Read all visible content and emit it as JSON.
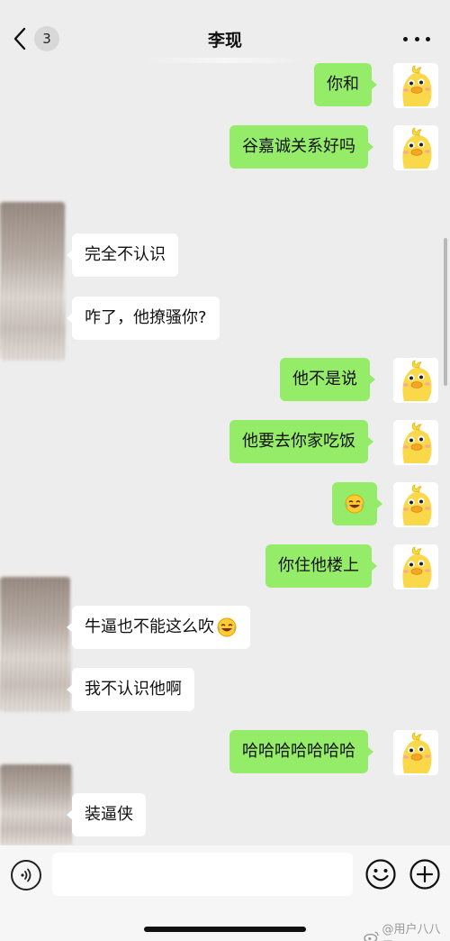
{
  "header": {
    "unread_count": "3",
    "title": "李现"
  },
  "messages": [
    {
      "side": "me",
      "text": "你和"
    },
    {
      "side": "me",
      "text": "谷嘉诚关系好吗"
    },
    {
      "side": "them",
      "text": "完全不认识"
    },
    {
      "side": "them",
      "text": "咋了，他撩骚你?"
    },
    {
      "side": "me",
      "text": "他不是说"
    },
    {
      "side": "me",
      "text": "他要去你家吃饭"
    },
    {
      "side": "me",
      "text": "",
      "emoji": "rofl-emoji-icon"
    },
    {
      "side": "me",
      "text": "你住他楼上"
    },
    {
      "side": "them",
      "text": "牛逼也不能这么吹",
      "emoji": "rofl-emoji-icon"
    },
    {
      "side": "them",
      "text": "我不认识他啊"
    },
    {
      "side": "me",
      "text": "哈哈哈哈哈哈哈"
    },
    {
      "side": "them",
      "text": "装逼侠"
    }
  ],
  "input": {
    "value": "",
    "placeholder": ""
  },
  "watermark": "@用户八八子",
  "colors": {
    "background": "#ededed",
    "my_bubble": "#95ec69",
    "their_bubble": "#ffffff",
    "avatar_duck": "#f9d84a"
  },
  "icons": [
    "chevron-left-icon",
    "more-dots-icon",
    "duck-avatar-icon",
    "voice-icon",
    "emoji-face-icon",
    "plus-circle-icon",
    "weibo-icon"
  ]
}
